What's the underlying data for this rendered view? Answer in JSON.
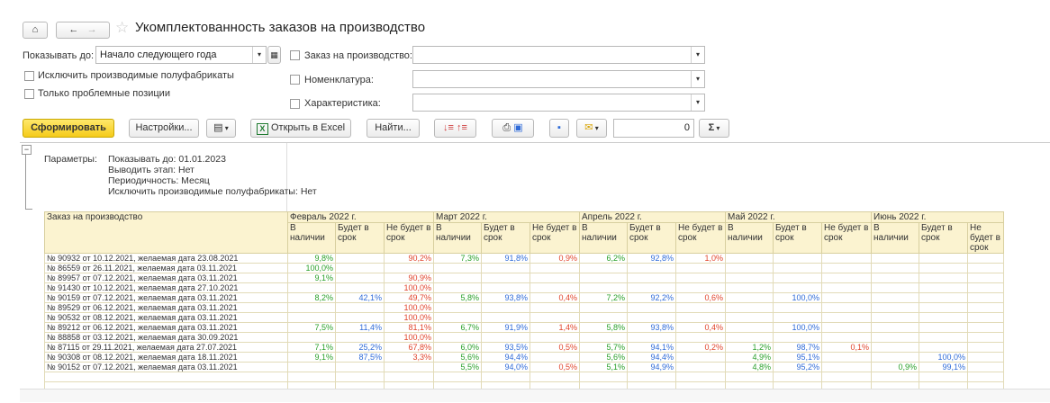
{
  "title": "Укомплектованность заказов на производство",
  "toolbar_top": {
    "home_icon": "home-icon",
    "back_icon": "back-icon",
    "forward_icon": "forward-icon",
    "star_icon": "star-icon"
  },
  "filters": {
    "show_until_label": "Показывать до:",
    "show_until_value": "Начало следующего года",
    "exclude_semi_label": "Исключить производимые полуфабрикаты",
    "only_problem_label": "Только проблемные позиции",
    "order_label": "Заказ на производство:",
    "nomenclature_label": "Номенклатура:",
    "characteristic_label": "Характеристика:"
  },
  "actions": {
    "generate": "Сформировать",
    "settings": "Настройки...",
    "export_excel": "Открыть в Excel",
    "find": "Найти...",
    "amount_value": "0",
    "sigma": "Σ"
  },
  "params": {
    "label": "Параметры:",
    "lines": [
      "Показывать до: 01.01.2023",
      "Выводить этап: Нет",
      "Периодичность: Месяц",
      "Исключить производимые полуфабрикаты: Нет"
    ]
  },
  "table": {
    "order_header": "Заказ на производство",
    "months": [
      "Февраль 2022 г.",
      "Март 2022 г.",
      "Апрель 2022 г.",
      "Май 2022 г.",
      "Июнь 2022 г."
    ],
    "subcols": [
      "В наличии",
      "Будет в срок",
      "Не будет в срок"
    ],
    "rows": [
      {
        "order": "№ 90932 от 10.12.2021, желаемая дата 23.08.2021",
        "v": [
          "9,8%",
          "",
          "90,2%",
          "7,3%",
          "91,8%",
          "0,9%",
          "6,2%",
          "92,8%",
          "1,0%",
          "",
          "",
          "",
          "",
          "",
          ""
        ]
      },
      {
        "order": "№ 86559 от 26.11.2021, желаемая дата 03.11.2021",
        "v": [
          "100,0%",
          "",
          "",
          "",
          "",
          "",
          "",
          "",
          "",
          "",
          "",
          "",
          "",
          "",
          ""
        ]
      },
      {
        "order": "№ 89957 от 07.12.2021, желаемая дата 03.11.2021",
        "v": [
          "9,1%",
          "",
          "90,9%",
          "",
          "",
          "",
          "",
          "",
          "",
          "",
          "",
          "",
          "",
          "",
          ""
        ]
      },
      {
        "order": "№ 91430 от 10.12.2021, желаемая дата 27.10.2021",
        "v": [
          "",
          "",
          "100,0%",
          "",
          "",
          "",
          "",
          "",
          "",
          "",
          "",
          "",
          "",
          "",
          ""
        ]
      },
      {
        "order": "№ 90159 от 07.12.2021, желаемая дата 03.11.2021",
        "v": [
          "8,2%",
          "42,1%",
          "49,7%",
          "5,8%",
          "93,8%",
          "0,4%",
          "7,2%",
          "92,2%",
          "0,6%",
          "",
          "100,0%",
          "",
          "",
          "",
          ""
        ]
      },
      {
        "order": "№ 89529 от 06.12.2021, желаемая дата 03.11.2021",
        "v": [
          "",
          "",
          "100,0%",
          "",
          "",
          "",
          "",
          "",
          "",
          "",
          "",
          "",
          "",
          "",
          ""
        ]
      },
      {
        "order": "№ 90532 от 08.12.2021, желаемая дата 03.11.2021",
        "v": [
          "",
          "",
          "100,0%",
          "",
          "",
          "",
          "",
          "",
          "",
          "",
          "",
          "",
          "",
          "",
          ""
        ]
      },
      {
        "order": "№ 89212 от 06.12.2021, желаемая дата 03.11.2021",
        "v": [
          "7,5%",
          "11,4%",
          "81,1%",
          "6,7%",
          "91,9%",
          "1,4%",
          "5,8%",
          "93,8%",
          "0,4%",
          "",
          "100,0%",
          "",
          "",
          "",
          ""
        ]
      },
      {
        "order": "№ 88858 от 03.12.2021, желаемая дата 30.09.2021",
        "v": [
          "",
          "",
          "100,0%",
          "",
          "",
          "",
          "",
          "",
          "",
          "",
          "",
          "",
          "",
          "",
          ""
        ]
      },
      {
        "order": "№ 87115 от 29.11.2021, желаемая дата 27.07.2021",
        "v": [
          "7,1%",
          "25,2%",
          "67,8%",
          "6,0%",
          "93,5%",
          "0,5%",
          "5,7%",
          "94,1%",
          "0,2%",
          "1,2%",
          "98,7%",
          "0,1%",
          "",
          "",
          ""
        ]
      },
      {
        "order": "№ 90308 от 08.12.2021, желаемая дата 18.11.2021",
        "v": [
          "9,1%",
          "87,5%",
          "3,3%",
          "5,6%",
          "94,4%",
          "",
          "5,6%",
          "94,4%",
          "",
          "4,9%",
          "95,1%",
          "",
          "",
          "100,0%",
          ""
        ]
      },
      {
        "order": "№ 90152 от 07.12.2021, желаемая дата 03.11.2021",
        "v": [
          "",
          "",
          "",
          "5,5%",
          "94,0%",
          "0,5%",
          "5,1%",
          "94,9%",
          "",
          "4,8%",
          "95,2%",
          "",
          "0,9%",
          "99,1%",
          ""
        ]
      }
    ]
  },
  "colors": {
    "in_stock": "#2aa02a",
    "on_time": "#2f6bd8",
    "late": "#e0442b",
    "accent": "#f5cb1a"
  }
}
